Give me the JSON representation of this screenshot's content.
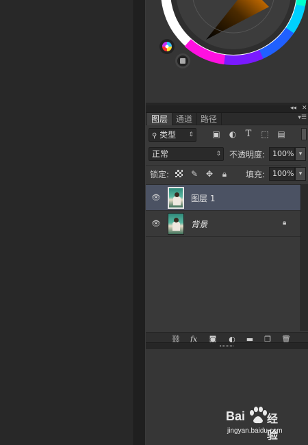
{
  "layers_panel": {
    "tabs": [
      {
        "label": "图层",
        "active": true
      },
      {
        "label": "通道",
        "active": false
      },
      {
        "label": "路径",
        "active": false
      }
    ],
    "filter": {
      "label": "类型",
      "icons": [
        "image-filter-icon",
        "adjustment-filter-icon",
        "type-filter-icon",
        "shape-filter-icon",
        "smart-object-filter-icon"
      ]
    },
    "blend_mode": "正常",
    "opacity_label": "不透明度:",
    "opacity_value": "100%",
    "lock_label": "锁定:",
    "fill_label": "填充:",
    "fill_value": "100%",
    "layers": [
      {
        "name": "图层 1",
        "selected": true,
        "locked": false
      },
      {
        "name": "背景",
        "selected": false,
        "locked": true
      }
    ]
  },
  "colors": {
    "selected_layer_bg": "#4b5263",
    "panel_bg": "#393939"
  },
  "watermark": {
    "brand": "Bai",
    "brand_suffix": "经验",
    "url": "jingyan.baidu.com"
  }
}
